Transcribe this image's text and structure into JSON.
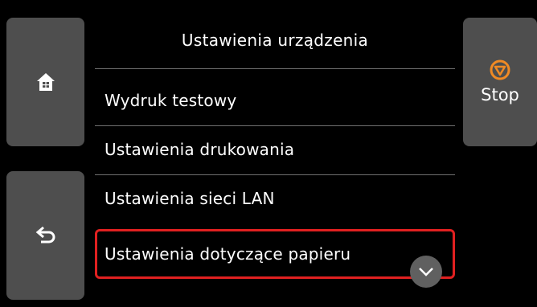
{
  "header": {
    "title": "Ustawienia urządzenia"
  },
  "menu": {
    "items": [
      {
        "label": "Wydruk testowy"
      },
      {
        "label": "Ustawienia drukowania"
      },
      {
        "label": "Ustawienia sieci LAN"
      },
      {
        "label": "Ustawienia dotyczące papieru"
      }
    ]
  },
  "buttons": {
    "home_icon": "home-icon",
    "back_icon": "back-arrow-icon",
    "stop_label": "Stop",
    "stop_icon": "stop-icon",
    "scroll_icon": "chevron-down-icon"
  },
  "colors": {
    "background": "#000000",
    "button": "#4e4e4e",
    "accent_orange": "#f08a24",
    "selection_red": "#e02020"
  }
}
